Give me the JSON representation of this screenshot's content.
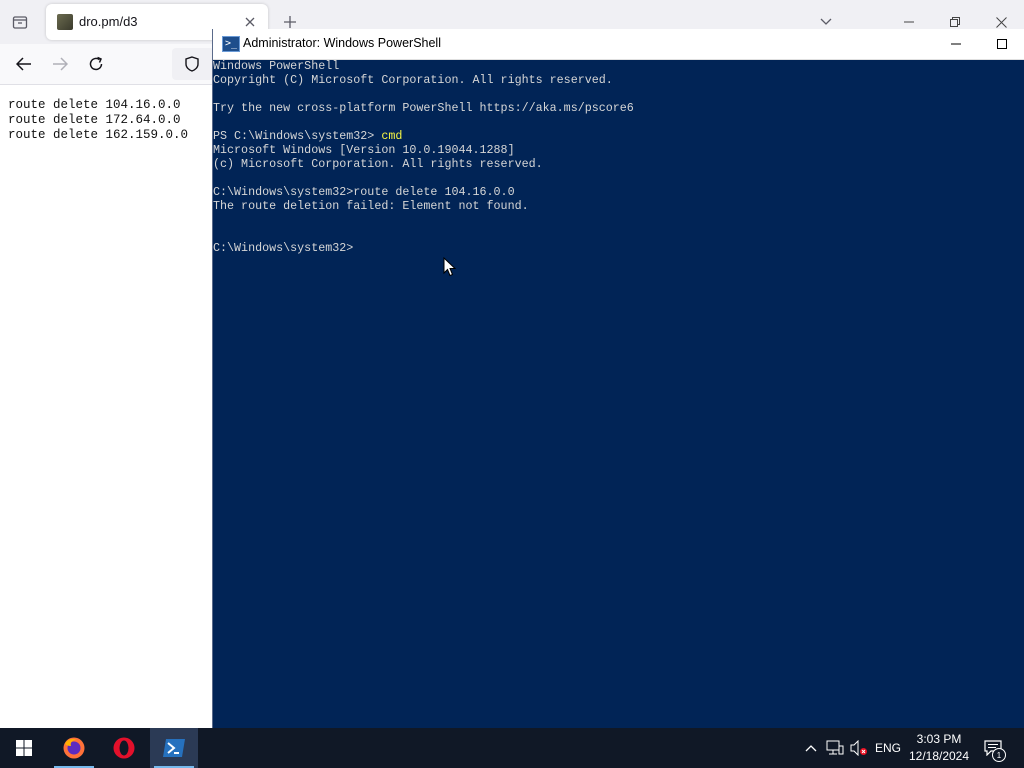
{
  "browser": {
    "tab": {
      "title": "dro.pm/d3"
    },
    "page": {
      "lines": [
        "route delete 104.16.0.0",
        "route delete 172.64.0.0",
        "route delete 162.159.0.0"
      ]
    }
  },
  "powershell": {
    "title": "Administrator: Windows PowerShell",
    "lines": {
      "l1": "Windows PowerShell",
      "l2": "Copyright (C) Microsoft Corporation. All rights reserved.",
      "l3": "Try the new cross-platform PowerShell https://aka.ms/pscore6",
      "l4_prompt": "PS C:\\Windows\\system32> ",
      "l4_cmd": "cmd",
      "l5": "Microsoft Windows [Version 10.0.19044.1288]",
      "l6": "(c) Microsoft Corporation. All rights reserved.",
      "l7": "C:\\Windows\\system32>route delete 104.16.0.0",
      "l8": "The route deletion failed: Element not found.",
      "l9": "C:\\Windows\\system32>"
    },
    "colors": {
      "background": "#012456",
      "text": "#d6d6d6",
      "command": "#f5f543"
    }
  },
  "taskbar": {
    "apps": [
      "start-icon",
      "firefox-icon",
      "opera-icon",
      "powershell-icon"
    ],
    "language": "ENG",
    "time": "3:03 PM",
    "date": "12/18/2024",
    "notification_count": "1"
  }
}
